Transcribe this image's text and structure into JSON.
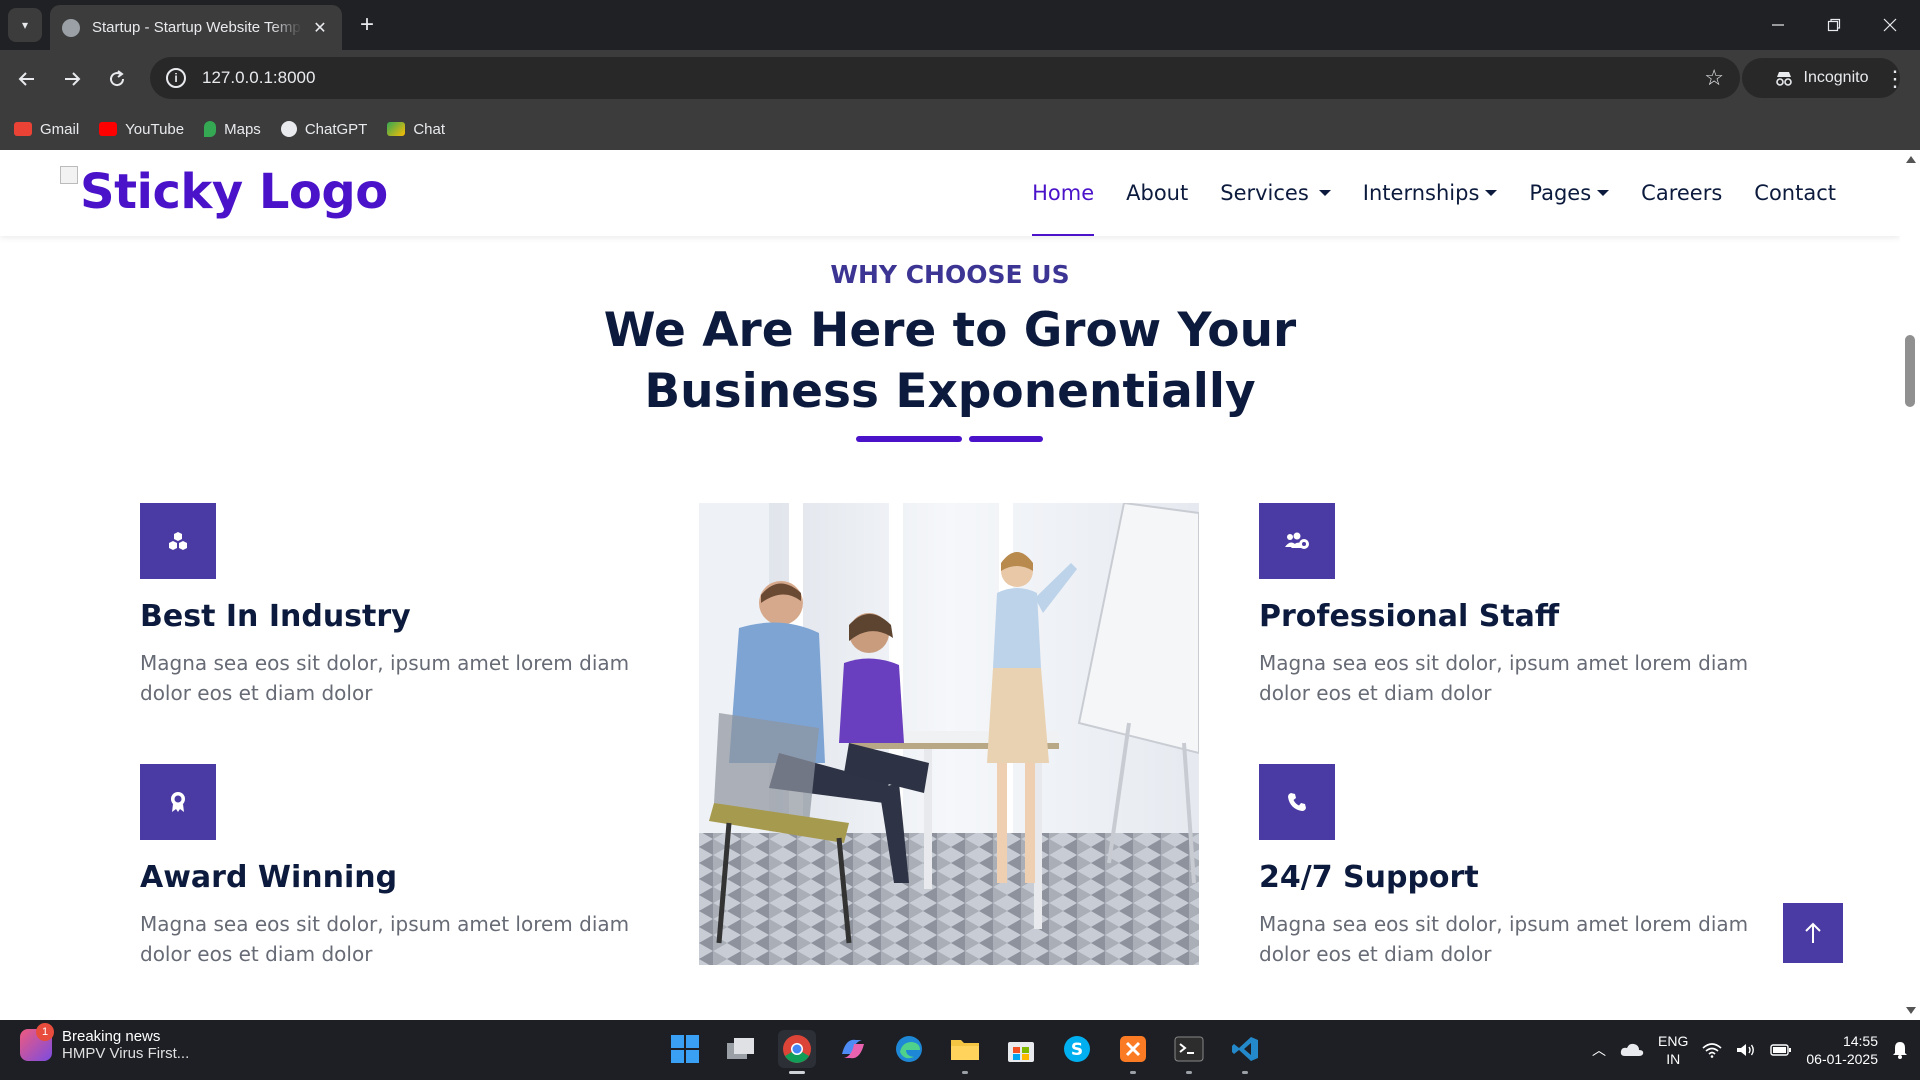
{
  "browser": {
    "tab_title": "Startup - Startup Website Template",
    "tab_close": "✕",
    "new_tab": "+",
    "url": "127.0.0.1:8000",
    "incognito_label": "Incognito",
    "bookmarks": [
      {
        "label": "Gmail",
        "icon": "gmail-icon",
        "color": "#ea4335"
      },
      {
        "label": "YouTube",
        "icon": "youtube-icon",
        "color": "#ff0000"
      },
      {
        "label": "Maps",
        "icon": "maps-icon",
        "color": "#34a853"
      },
      {
        "label": "ChatGPT",
        "icon": "chatgpt-icon",
        "color": "#e8eaed"
      },
      {
        "label": "Chat",
        "icon": "chat-icon",
        "color": "#1e8e3e"
      }
    ]
  },
  "site": {
    "logo_text": "Sticky Logo",
    "nav": [
      {
        "label": "Home",
        "active": true,
        "dropdown": false
      },
      {
        "label": "About",
        "active": false,
        "dropdown": false
      },
      {
        "label": "Services",
        "active": false,
        "dropdown": true
      },
      {
        "label": "Internships",
        "active": false,
        "dropdown": true
      },
      {
        "label": "Pages",
        "active": false,
        "dropdown": true
      },
      {
        "label": "Careers",
        "active": false,
        "dropdown": false
      },
      {
        "label": "Contact",
        "active": false,
        "dropdown": false
      }
    ],
    "section": {
      "subtitle": "WHY CHOOSE US",
      "title_line1": "We Are Here to Grow Your",
      "title_line2": "Business Exponentially"
    },
    "features": [
      {
        "title": "Best In Industry",
        "text": "Magna sea eos sit dolor, ipsum amet lorem diam dolor eos et diam dolor",
        "icon": "cubes-icon"
      },
      {
        "title": "Award Winning",
        "text": "Magna sea eos sit dolor, ipsum amet lorem diam dolor eos et diam dolor",
        "icon": "award-icon"
      },
      {
        "title": "Professional Staff",
        "text": "Magna sea eos sit dolor, ipsum amet lorem diam dolor eos et diam dolor",
        "icon": "users-cog-icon"
      },
      {
        "title": "24/7 Support",
        "text": "Magna sea eos sit dolor, ipsum amet lorem diam dolor eos et diam dolor",
        "icon": "phone-icon"
      }
    ],
    "back_to_top": "↑",
    "colors": {
      "primary": "#4a13c9",
      "icon_bg": "#4a3aa3",
      "heading": "#0c1b3d",
      "body_text": "#676b75"
    }
  },
  "taskbar": {
    "news_badge": "1",
    "news_title": "Breaking news",
    "news_subtitle": "HMPV Virus First...",
    "lang_line1": "ENG",
    "lang_line2": "IN",
    "time": "14:55",
    "date": "06-01-2025"
  }
}
